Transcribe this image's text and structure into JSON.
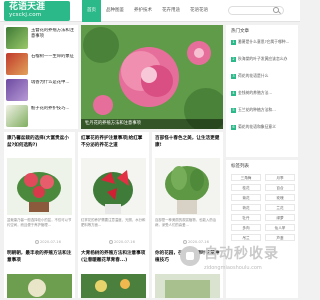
{
  "header": {
    "logo_text": "花语天涯",
    "logo_sub": "ycsckj.com",
    "nav": [
      "首页",
      "品种图鉴",
      "养护技术",
      "花卉用途",
      "花语花语"
    ],
    "search_placeholder": ""
  },
  "sidebar": {
    "items": [
      {
        "title": "玉簪花的养殖方法和注意事项"
      },
      {
        "title": "石榴树——生命的象征"
      },
      {
        "title": "瑞香为什么是花中..."
      },
      {
        "title": "栀子花的养护技巧..."
      }
    ]
  },
  "hero": {
    "caption": "牡丹花的养殖方法和注意事项"
  },
  "right": {
    "heading": "热门文章",
    "hot": [
      "番薯是什么意思?它属于哪种...",
      "秋海棠的叶子发黄应该怎么办",
      "荷花的花语是什么",
      "金钱树的养殖方法...",
      "玉兰花的种植方法和...",
      "菊花的花语和象征意义"
    ]
  },
  "tags": {
    "heading": "标签列表",
    "items": [
      "三角梅",
      "月季",
      "桂花",
      "百合",
      "菊花",
      "玫瑰",
      "荷花",
      "兰花",
      "牡丹",
      "绿萝",
      "多肉",
      "仙人掌",
      "吊兰",
      "芦荟"
    ]
  },
  "cards": [
    {
      "title": "康乃馨盆栽的选择(大富贵盆小盆?如何选购?)",
      "desc": "盆栽康乃馨一般选择较小的盆，不仅可以节约空间，而且便于养护管理...",
      "time": "2020-07-16",
      "title2": "明朝朝，最丰收的养殖方法和注意事项"
    },
    {
      "title": "红掌花的养护注意事项|给红掌不分泌的养花之道",
      "desc": "红掌花的养护需要注意温度、光照、水分和肥料等方面...",
      "time": "2020-07-16",
      "title2": "大青杨树的养殖方法和注意事项(让春暖雕花草青春...)"
    },
    {
      "title": "百部怪十春色之美，让生活更健康!",
      "desc": "百部是一种美丽的观赏植物，也能入药治病，深受人们的喜爱...",
      "time": "2020-07-16",
      "title2": "你的花园，在家里的绿叶花草种植技巧"
    }
  ],
  "watermark": {
    "text": "自动秒收录",
    "sub": "zidongmiaoshoulu.com"
  }
}
